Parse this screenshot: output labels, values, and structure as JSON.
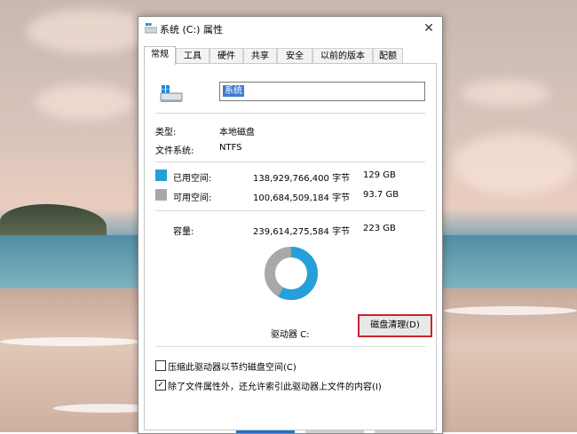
{
  "window": {
    "title": "系统 (C:) 属性",
    "close_icon": "close-icon"
  },
  "tabs": [
    {
      "label": "常规"
    },
    {
      "label": "工具"
    },
    {
      "label": "硬件"
    },
    {
      "label": "共享"
    },
    {
      "label": "安全"
    },
    {
      "label": "以前的版本"
    },
    {
      "label": "配额"
    }
  ],
  "general": {
    "drive_name": "系统",
    "type_label": "类型:",
    "type_value": "本地磁盘",
    "fs_label": "文件系统:",
    "fs_value": "NTFS",
    "used": {
      "label": "已用空间:",
      "bytes": "138,929,766,400 字节",
      "size": "129 GB",
      "color": "#26a0da"
    },
    "free": {
      "label": "可用空间:",
      "bytes": "100,684,509,184 字节",
      "size": "93.7 GB",
      "color": "#a8a8a8"
    },
    "capacity": {
      "label": "容量:",
      "bytes": "239,614,275,584 字节",
      "size": "223 GB"
    },
    "used_fraction": 0.58,
    "drive_label": "驱动器 C:",
    "cleanup_button": "磁盘清理(D)",
    "compress_label": "压缩此驱动器以节约磁盘空间(C)",
    "compress_checked": false,
    "index_label": "除了文件属性外，还允许索引此驱动器上文件的内容(I)",
    "index_checked": true
  }
}
